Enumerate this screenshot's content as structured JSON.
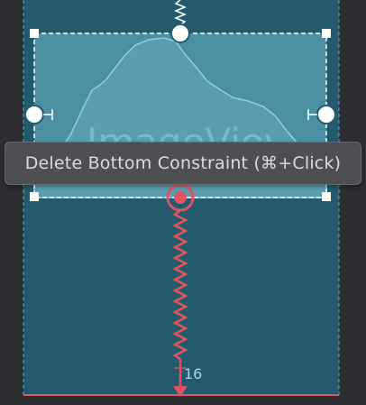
{
  "tooltip": {
    "text": "Delete Bottom Constraint (⌘+Click)"
  },
  "imageview": {
    "label": "ImageView"
  },
  "constraint": {
    "bottom_margin": "16"
  },
  "colors": {
    "background": "#2b2d30",
    "layout_fill": "#235a6e",
    "imageview_fill": "#4b8fa3",
    "constraint_red": "#e0545f",
    "selection_white": "#ffffff"
  },
  "icons": {
    "top_constraint": "zigzag-spring-icon",
    "bottom_anchor": "target-anchor-icon",
    "bottom_constraint": "zigzag-spring-icon",
    "arrow": "arrow-down-icon"
  }
}
